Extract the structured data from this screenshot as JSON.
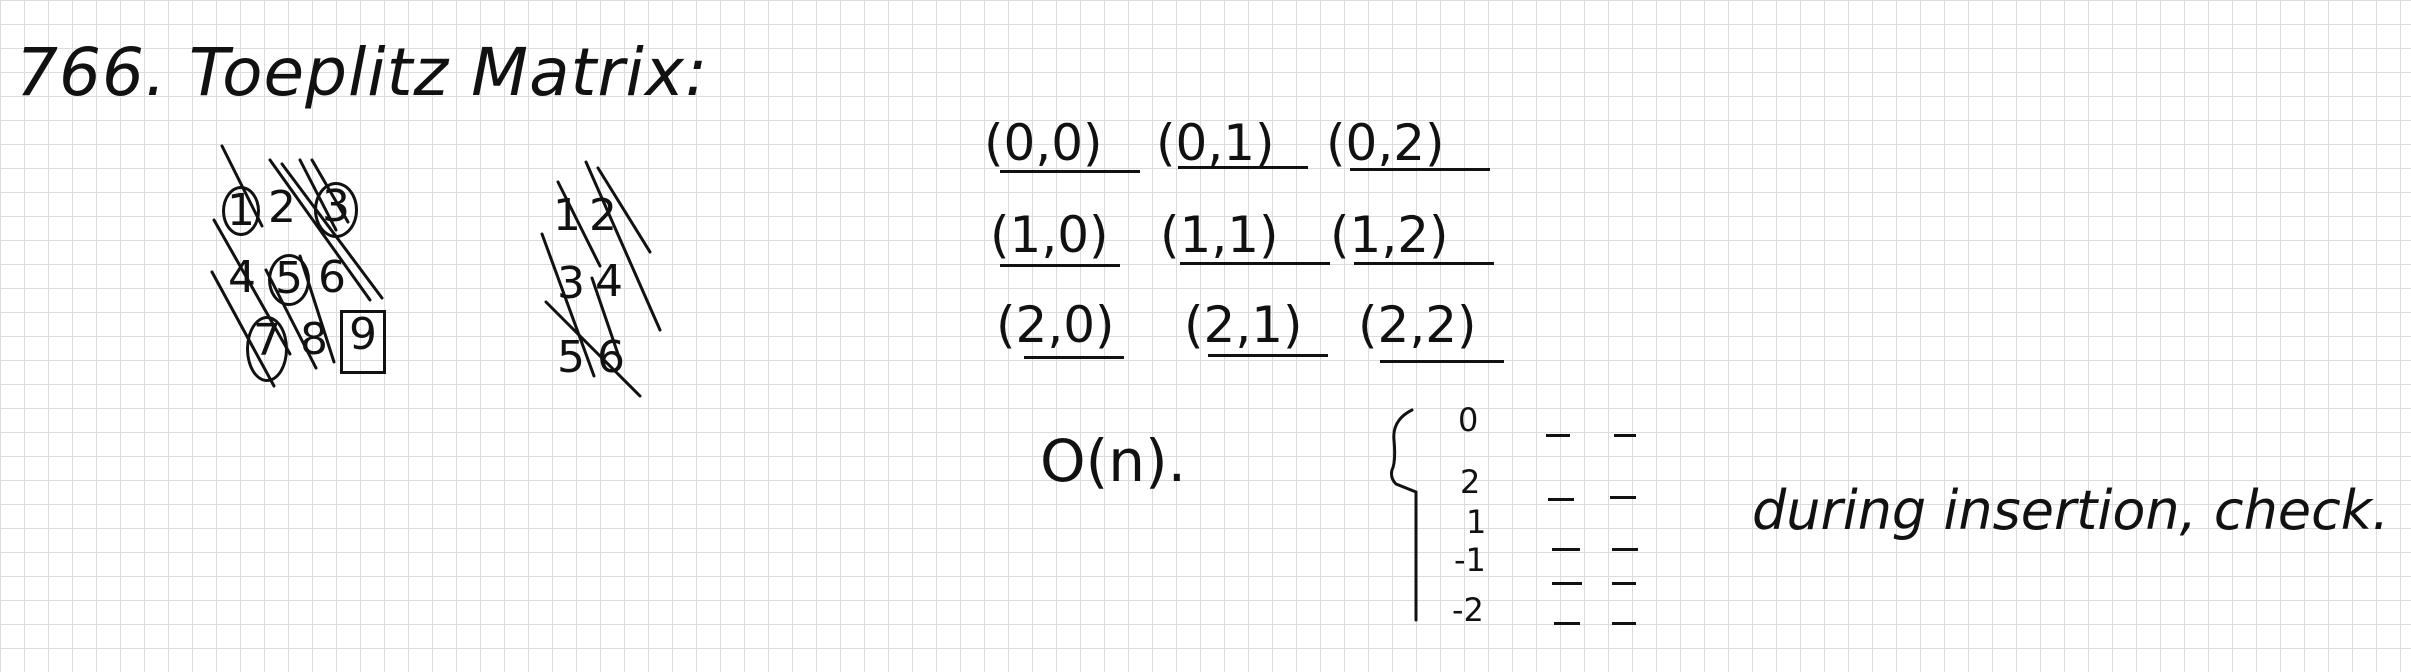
{
  "title": "766. Toeplitz Matrix:",
  "matrix_a": [
    "1",
    "2",
    "3",
    "4",
    "5",
    "6",
    "7",
    "8",
    "9"
  ],
  "matrix_b": [
    "1",
    "2",
    "3",
    "4",
    "5",
    "6"
  ],
  "coords": [
    [
      "(0,0)",
      "(0,1)",
      "(0,2)"
    ],
    [
      "(1,0)",
      "(1,1)",
      "(1,2)"
    ],
    [
      "(2,0)",
      "(2,1)",
      "(2,2)"
    ]
  ],
  "complexity": "O(n).",
  "diagonal_keys": [
    "0",
    "2",
    "1",
    "-1",
    "-2"
  ],
  "note": "during insertion, check."
}
